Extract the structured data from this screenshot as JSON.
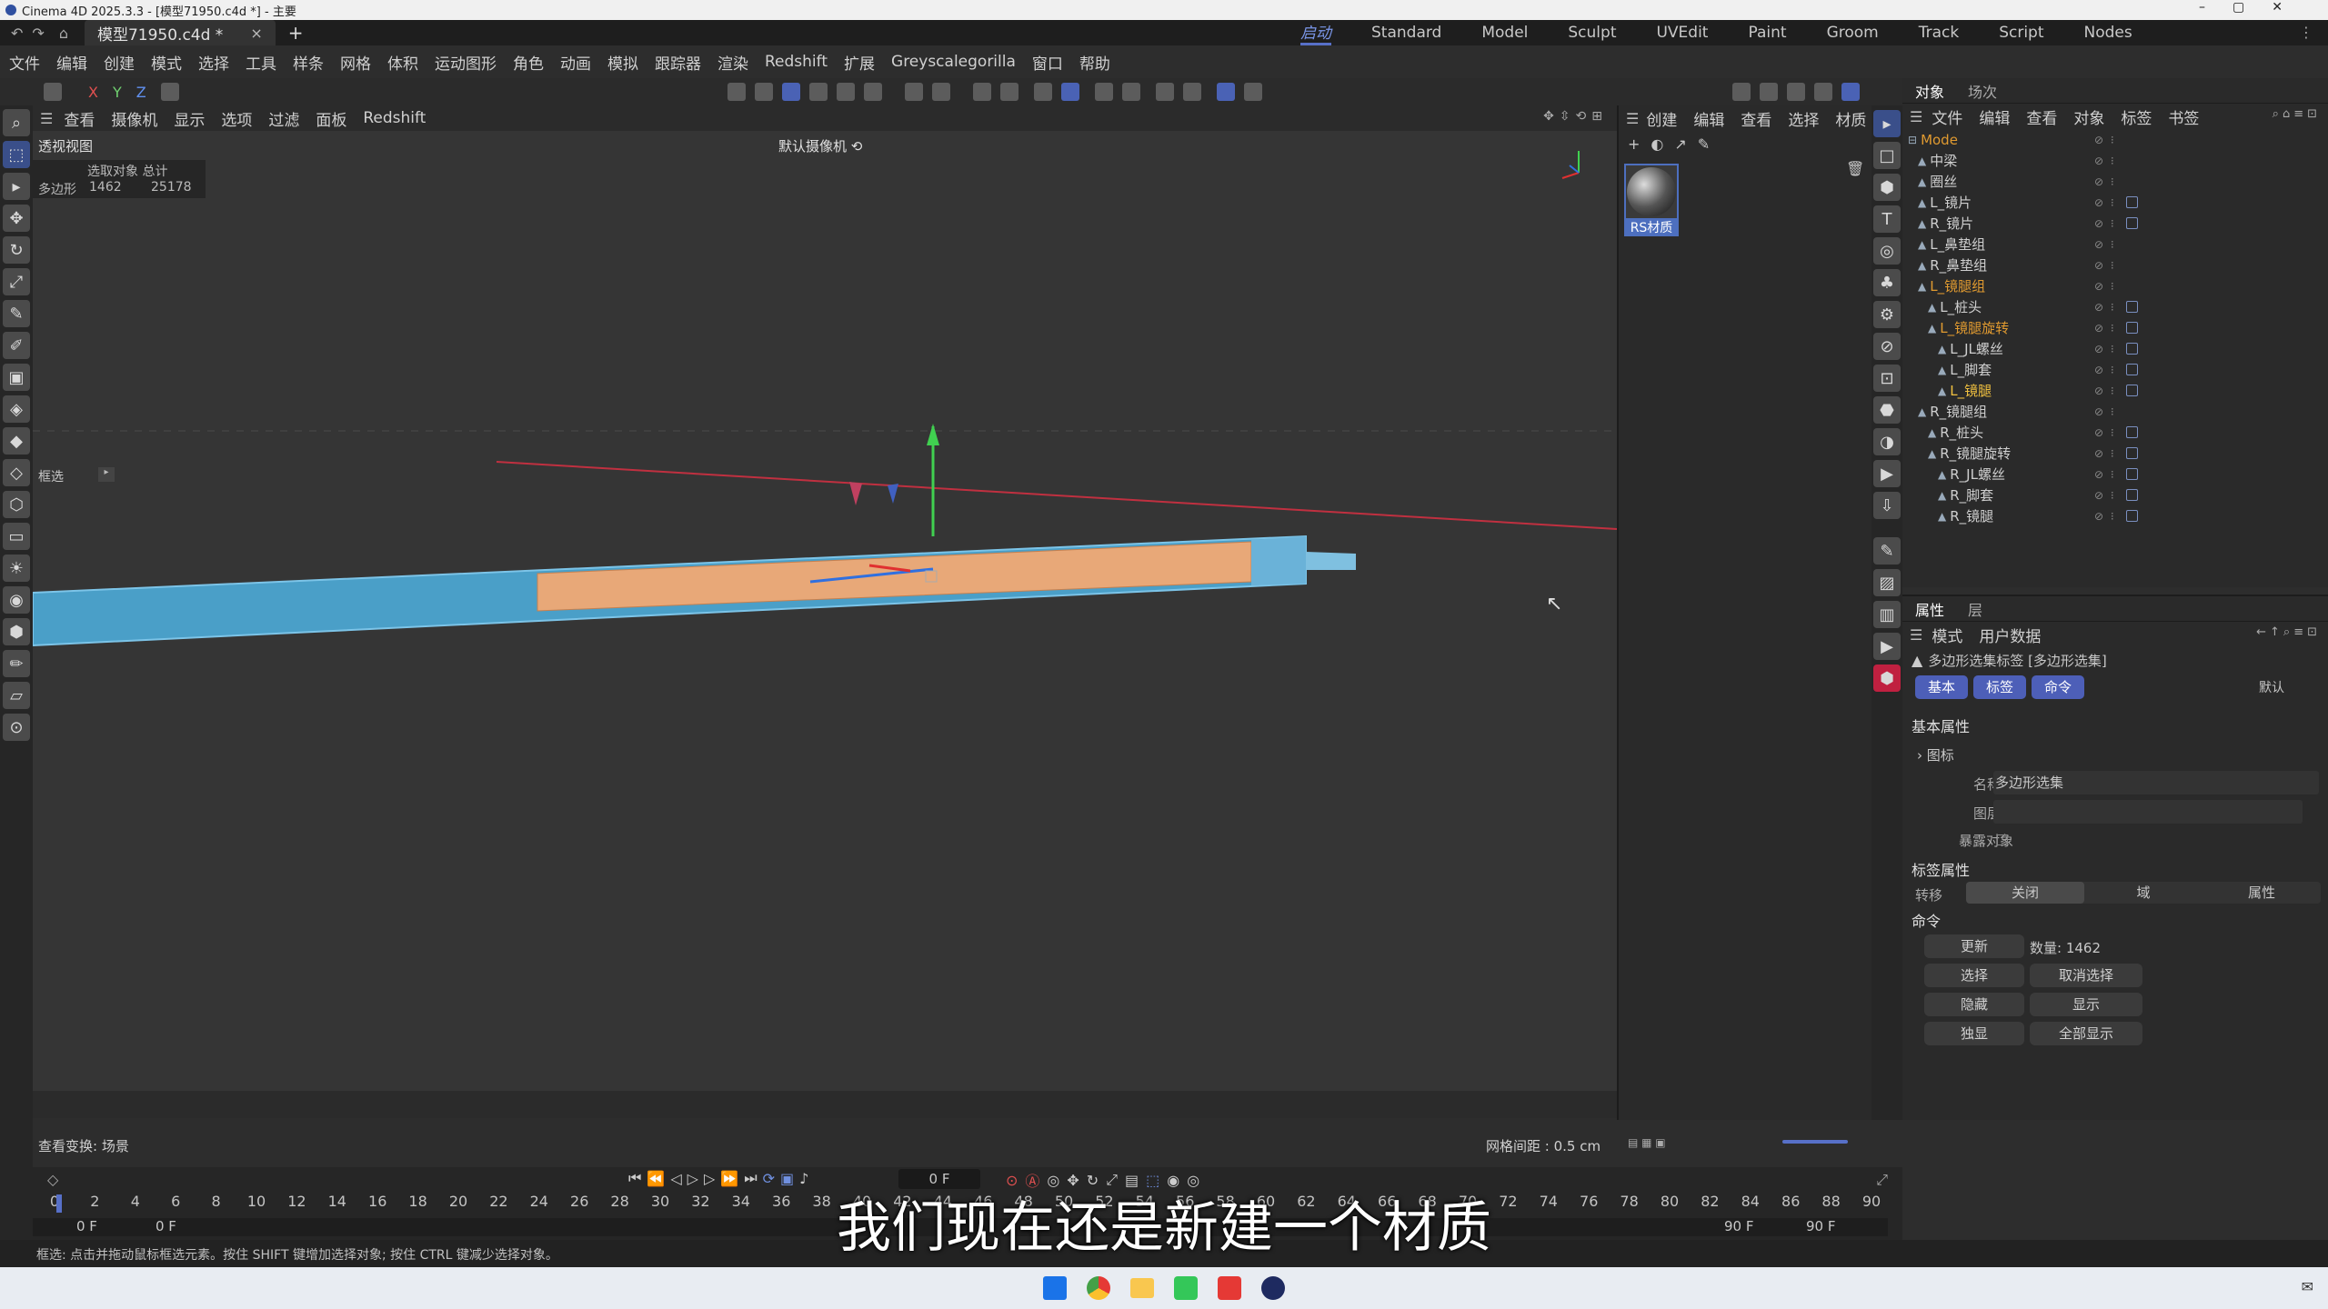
{
  "window": {
    "title": "Cinema 4D 2025.3.3 - [模型71950.c4d *] - 主要"
  },
  "tabs": {
    "doc": "模型71950.c4d *",
    "close": "×",
    "add": "+"
  },
  "layouts": [
    "启动",
    "Standard",
    "Model",
    "Sculpt",
    "UVEdit",
    "Paint",
    "Groom",
    "Track",
    "Script",
    "Nodes"
  ],
  "menu": [
    "文件",
    "编辑",
    "创建",
    "模式",
    "选择",
    "工具",
    "样条",
    "网格",
    "体积",
    "运动图形",
    "角色",
    "动画",
    "模拟",
    "跟踪器",
    "渲染",
    "Redshift",
    "扩展",
    "Greyscalegorilla",
    "窗口",
    "帮助"
  ],
  "axes": {
    "x": "X",
    "y": "Y",
    "z": "Z"
  },
  "viewport_menu": [
    "查看",
    "摄像机",
    "显示",
    "选项",
    "过滤",
    "面板",
    "Redshift"
  ],
  "viewport": {
    "name": "透视视图",
    "camera": "默认摄像机 ⟲",
    "stats_header": "选取对象 总计",
    "stats_label": "多边形",
    "stats_sel": "1462",
    "stats_total": "25178",
    "box_select": "框选",
    "status": "查看变换: 场景",
    "grid": "网格间距 : 0.5 cm"
  },
  "material_menu": [
    "创建",
    "编辑",
    "查看",
    "选择",
    "材质"
  ],
  "material": {
    "name": "RS材质"
  },
  "object_tabs": [
    "对象",
    "场次"
  ],
  "object_menu": [
    "文件",
    "编辑",
    "查看",
    "对象",
    "标签",
    "书签"
  ],
  "objects": [
    {
      "name": "Mode",
      "depth": 0,
      "color": "#e09a30"
    },
    {
      "name": "中梁",
      "depth": 1,
      "color": "#cfcfcf"
    },
    {
      "name": "圈丝",
      "depth": 1,
      "color": "#cfcfcf"
    },
    {
      "name": "L_镜片",
      "depth": 1,
      "color": "#cfcfcf"
    },
    {
      "name": "R_镜片",
      "depth": 1,
      "color": "#cfcfcf"
    },
    {
      "name": "L_鼻垫组",
      "depth": 1,
      "color": "#cfcfcf"
    },
    {
      "name": "R_鼻垫组",
      "depth": 1,
      "color": "#cfcfcf"
    },
    {
      "name": "L_镜腿组",
      "depth": 1,
      "color": "#e09a30"
    },
    {
      "name": "L_桩头",
      "depth": 2,
      "color": "#cfcfcf"
    },
    {
      "name": "L_镜腿旋转",
      "depth": 2,
      "color": "#e09a30"
    },
    {
      "name": "L_JL螺丝",
      "depth": 3,
      "color": "#cfcfcf"
    },
    {
      "name": "L_脚套",
      "depth": 3,
      "color": "#cfcfcf"
    },
    {
      "name": "L_镜腿",
      "depth": 3,
      "color": "#f0c040"
    },
    {
      "name": "R_镜腿组",
      "depth": 1,
      "color": "#cfcfcf"
    },
    {
      "name": "R_桩头",
      "depth": 2,
      "color": "#cfcfcf"
    },
    {
      "name": "R_镜腿旋转",
      "depth": 2,
      "color": "#cfcfcf"
    },
    {
      "name": "R_JL螺丝",
      "depth": 3,
      "color": "#cfcfcf"
    },
    {
      "name": "R_脚套",
      "depth": 3,
      "color": "#cfcfcf"
    },
    {
      "name": "R_镜腿",
      "depth": 3,
      "color": "#cfcfcf"
    }
  ],
  "attr_tabs": [
    "属性",
    "层"
  ],
  "attr_menu": [
    "模式",
    "用户数据"
  ],
  "attr": {
    "title": "多边形选集标签 [多边形选集]",
    "preset": "默认",
    "btn_basic": "基本",
    "btn_tag": "标签",
    "btn_cmd": "命令",
    "section_basic": "基本属性",
    "icon_label": "图标",
    "name_label": "名称",
    "name_value": "多边形选集",
    "layer_label": "图层",
    "expose_label": "暴露对象",
    "section_tag": "标签属性",
    "convert_label": "转移",
    "seg_off": "关闭",
    "seg_field": "域",
    "seg_attr": "属性",
    "section_cmd": "命令",
    "update": "更新",
    "count": "数量: 1462",
    "select": "选择",
    "deselect": "取消选择",
    "hide": "隐藏",
    "show": "显示",
    "solo": "独显",
    "show_all": "全部显示"
  },
  "timeline": {
    "ticks": [
      "0",
      "2",
      "4",
      "6",
      "8",
      "10",
      "12",
      "14",
      "16",
      "18",
      "20",
      "22",
      "24",
      "26",
      "28",
      "30",
      "32",
      "34",
      "36",
      "38",
      "40",
      "42",
      "44",
      "46",
      "48",
      "50",
      "52",
      "54",
      "56",
      "58",
      "60",
      "62",
      "64",
      "66",
      "68",
      "70",
      "72",
      "74",
      "76",
      "78",
      "80",
      "82",
      "84",
      "86",
      "88",
      "90"
    ],
    "current": "0 F",
    "start": "0 F",
    "start2": "0 F",
    "end": "90 F",
    "end2": "90 F"
  },
  "statusbar": "框选: 点击并拖动鼠标框选元素。按住 SHIFT 键增加选择对象; 按住 CTRL 键减少选择对象。",
  "subtitle": "我们现在还是新建一个材质"
}
